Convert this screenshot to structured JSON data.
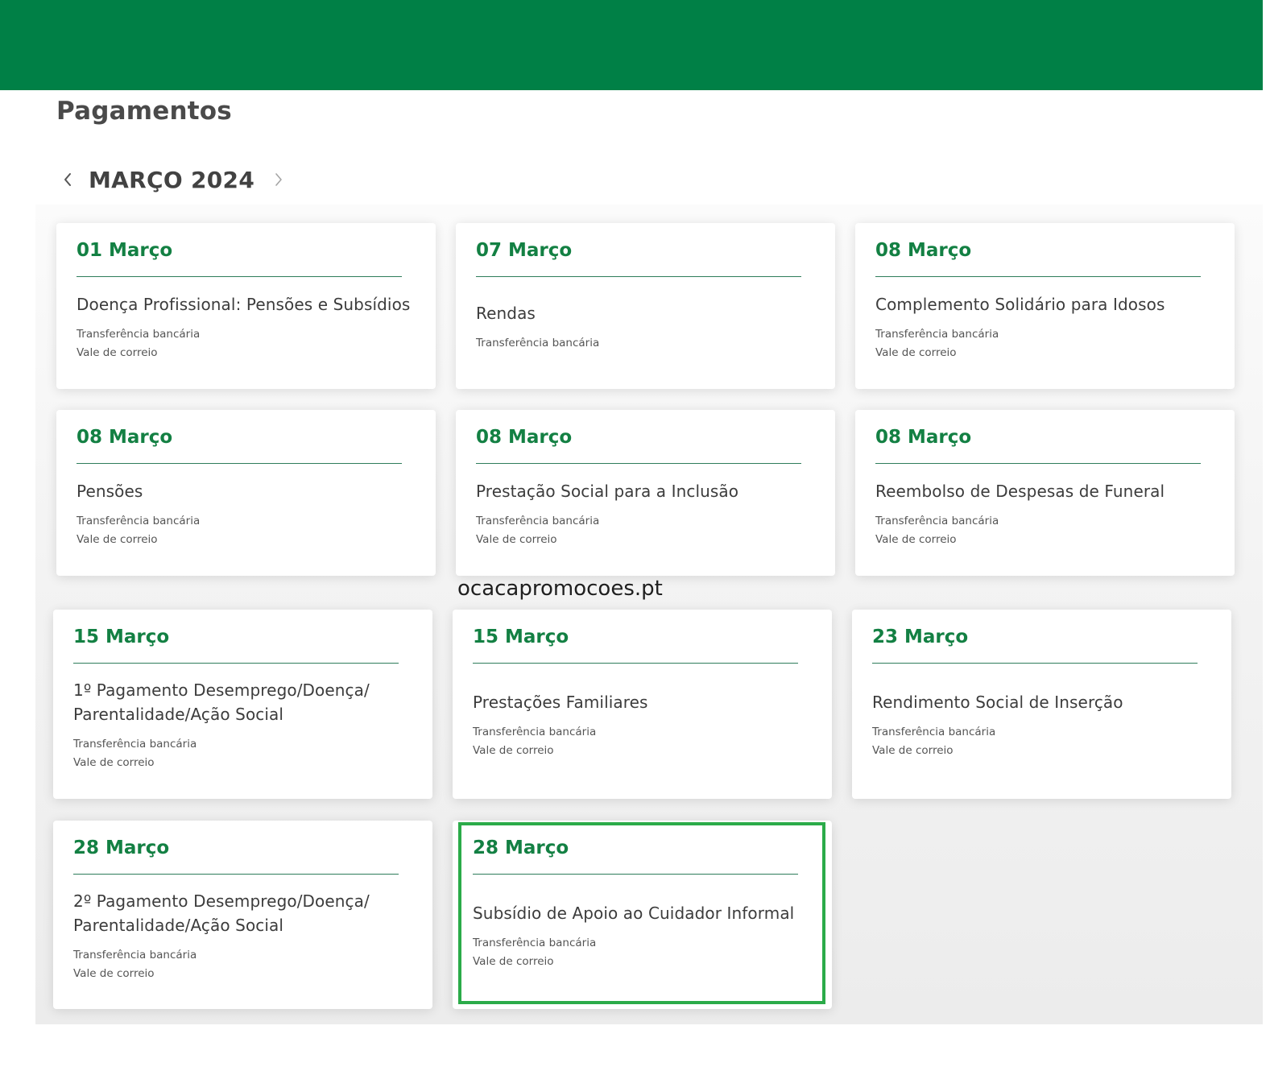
{
  "page": {
    "title": "Pagamentos",
    "month_label": "MARÇO 2024",
    "prev_icon": "chevron-left-icon",
    "next_icon": "chevron-right-icon"
  },
  "watermark": "ocacapromocoes.pt",
  "colors": {
    "header_green": "#008046",
    "date_green": "#138043",
    "divider_green": "#2e7d5b",
    "highlight_green": "#2bab49"
  },
  "cards": [
    {
      "date": "01 Março",
      "title_lines": [
        "Doença Profissional: Pensões e Subsídios"
      ],
      "methods": [
        "Transferência bancária",
        "Vale de correio"
      ]
    },
    {
      "date": "07 Março",
      "title_lines": [
        "Rendas"
      ],
      "methods": [
        "Transferência bancária"
      ]
    },
    {
      "date": "08 Março",
      "title_lines": [
        "Complemento Solidário para Idosos"
      ],
      "methods": [
        "Transferência bancária",
        "Vale de correio"
      ]
    },
    {
      "date": "08 Março",
      "title_lines": [
        "Pensões"
      ],
      "methods": [
        "Transferência bancária",
        "Vale de correio"
      ]
    },
    {
      "date": "08 Março",
      "title_lines": [
        "Prestação Social para a Inclusão"
      ],
      "methods": [
        "Transferência bancária",
        "Vale de correio"
      ]
    },
    {
      "date": "08 Março",
      "title_lines": [
        "Reembolso de Despesas de Funeral"
      ],
      "methods": [
        "Transferência bancária",
        "Vale de correio"
      ]
    },
    {
      "date": "15 Março",
      "title_lines": [
        "1º Pagamento Desemprego/Doença/",
        "Parentalidade/Ação Social"
      ],
      "methods": [
        "Transferência bancária",
        "Vale de correio"
      ]
    },
    {
      "date": "15 Março",
      "title_lines": [
        "Prestações Familiares"
      ],
      "methods": [
        "Transferência bancária",
        "Vale de correio"
      ]
    },
    {
      "date": "23 Março",
      "title_lines": [
        "Rendimento Social de Inserção"
      ],
      "methods": [
        "Transferência bancária",
        "Vale de correio"
      ]
    },
    {
      "date": "28 Março",
      "title_lines": [
        "2º Pagamento Desemprego/Doença/",
        "Parentalidade/Ação Social"
      ],
      "methods": [
        "Transferência bancária",
        "Vale de correio"
      ]
    },
    {
      "date": "28 Março",
      "title_lines": [
        "Subsídio de Apoio ao Cuidador Informal"
      ],
      "methods": [
        "Transferência bancária",
        "Vale de correio"
      ]
    }
  ]
}
